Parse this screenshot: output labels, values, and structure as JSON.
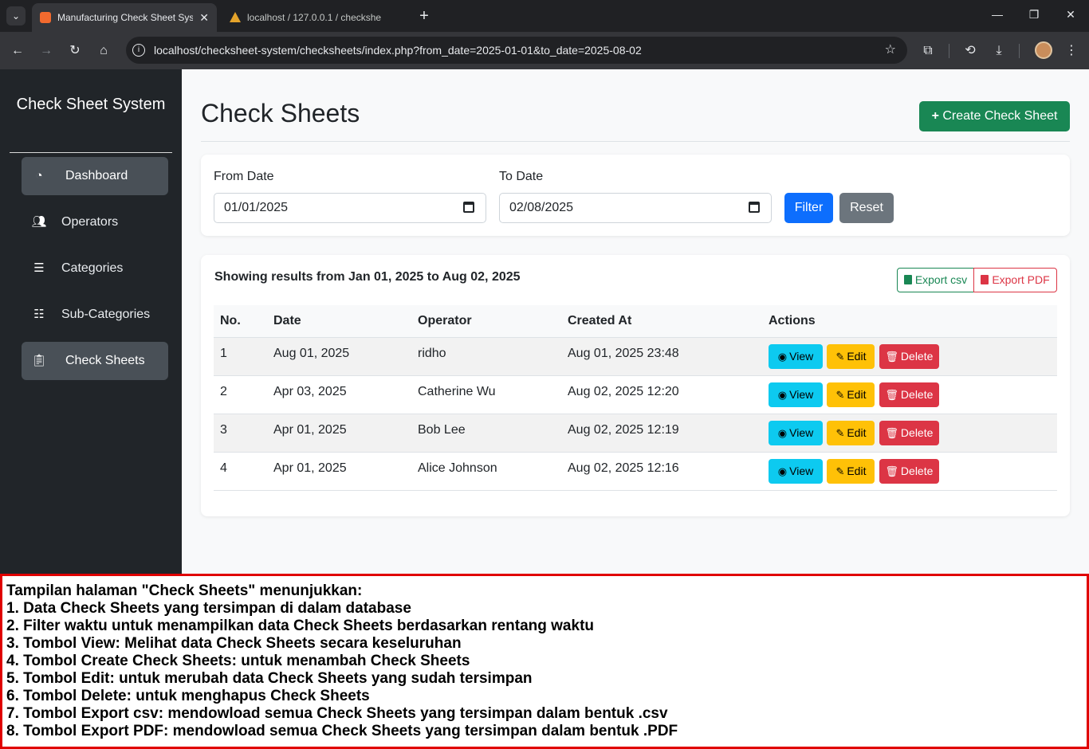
{
  "browser": {
    "tabs": [
      {
        "title": "Manufacturing Check Sheet Sys",
        "active": true
      },
      {
        "title": "localhost / 127.0.0.1 / checkshe",
        "active": false
      }
    ],
    "url": "localhost/checksheet-system/checksheets/index.php?from_date=2025-01-01&to_date=2025-08-02"
  },
  "sidebar": {
    "brand": "Check Sheet System",
    "items": [
      {
        "label": "Dashboard",
        "icon": "dashboard-icon",
        "active": true
      },
      {
        "label": "Operators",
        "icon": "users-icon",
        "active": false
      },
      {
        "label": "Categories",
        "icon": "list-icon",
        "active": false
      },
      {
        "label": "Sub-Categories",
        "icon": "list-ordered-icon",
        "active": false
      },
      {
        "label": "Check Sheets",
        "icon": "clipboard-icon",
        "active": true
      }
    ]
  },
  "page": {
    "title": "Check Sheets",
    "create_label": "Create Check Sheet"
  },
  "filter": {
    "from_label": "From Date",
    "from_value": "01/01/2025",
    "to_label": "To Date",
    "to_value": "02/08/2025",
    "filter_label": "Filter",
    "reset_label": "Reset"
  },
  "results": {
    "heading": "Showing results from Jan 01, 2025 to Aug 02, 2025",
    "export_csv": "Export csv",
    "export_pdf": "Export PDF",
    "columns": [
      "No.",
      "Date",
      "Operator",
      "Created At",
      "Actions"
    ],
    "rows": [
      {
        "no": "1",
        "date": "Aug 01, 2025",
        "operator": "ridho",
        "created_at": "Aug 01, 2025 23:48"
      },
      {
        "no": "2",
        "date": "Apr 03, 2025",
        "operator": "Catherine Wu",
        "created_at": "Aug 02, 2025 12:20"
      },
      {
        "no": "3",
        "date": "Apr 01, 2025",
        "operator": "Bob Lee",
        "created_at": "Aug 02, 2025 12:19"
      },
      {
        "no": "4",
        "date": "Apr 01, 2025",
        "operator": "Alice Johnson",
        "created_at": "Aug 02, 2025 12:16"
      }
    ],
    "view_label": "View",
    "edit_label": "Edit",
    "delete_label": "Delete"
  },
  "annotation": {
    "lines": [
      "Tampilan halaman \"Check Sheets\" menunjukkan:",
      "1. Data Check Sheets yang tersimpan di dalam database",
      "2. Filter waktu untuk menampilkan data Check Sheets berdasarkan rentang waktu",
      "3. Tombol View: Melihat data Check Sheets secara keseluruhan",
      "4. Tombol Create Check Sheets: untuk menambah Check Sheets",
      "5. Tombol Edit: untuk merubah data Check Sheets yang sudah tersimpan",
      "6. Tombol Delete: untuk menghapus Check Sheets",
      "7. Tombol Export csv: mendowload semua Check Sheets yang tersimpan dalam bentuk .csv",
      "8. Tombol Export PDF: mendowload semua Check Sheets yang tersimpan dalam bentuk .PDF"
    ]
  },
  "colors": {
    "sidebar": "#212529",
    "success": "#198754",
    "primary": "#0d6efd",
    "info": "#0dcaf0",
    "warning": "#ffc107",
    "danger": "#dc3545",
    "annotation_border": "#e00000"
  }
}
